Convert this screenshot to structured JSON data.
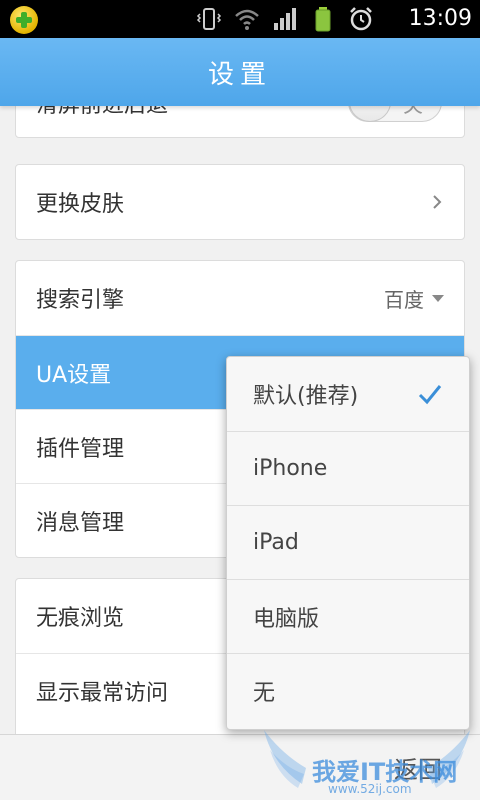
{
  "status_bar": {
    "time": "13:09",
    "icons": [
      "app-badge-icon",
      "vibrate-icon",
      "wifi-icon",
      "signal-icon",
      "battery-icon",
      "alarm-icon"
    ]
  },
  "header": {
    "title": "设置"
  },
  "settings": {
    "scrolled_row": {
      "label": "滑屏前进后退",
      "toggle_label": "关"
    },
    "skin_row": {
      "label": "更换皮肤"
    },
    "group2": [
      {
        "label": "搜索引擎",
        "value": "百度"
      },
      {
        "label": "UA设置"
      },
      {
        "label": "插件管理"
      },
      {
        "label": "消息管理"
      }
    ],
    "group3": [
      {
        "label": "无痕浏览"
      },
      {
        "label": "显示最常访问"
      }
    ]
  },
  "ua_menu": {
    "options": [
      "默认(推荐)",
      "iPhone",
      "iPad",
      "电脑版",
      "无"
    ],
    "selected": "默认(推荐)"
  },
  "bottom_bar": {
    "back_label": "返回"
  },
  "watermark": {
    "text": "我爱IT技术网",
    "sub": "www.52ij.com"
  },
  "colors": {
    "accent": "#4ea6ea",
    "active_row": "#5aaeed",
    "check": "#3b8fd8"
  }
}
